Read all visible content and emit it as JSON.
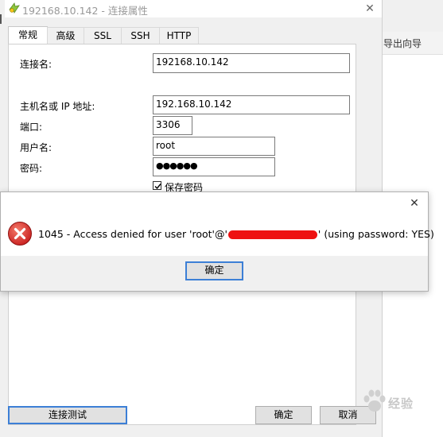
{
  "background_app": {
    "toolbar_label": "导出向导"
  },
  "dialog": {
    "title": "192168.10.142 - 连接属性",
    "tabs": [
      {
        "label": "常规",
        "active": true
      },
      {
        "label": "高级",
        "active": false
      },
      {
        "label": "SSL",
        "active": false
      },
      {
        "label": "SSH",
        "active": false
      },
      {
        "label": "HTTP",
        "active": false
      }
    ],
    "fields": {
      "connection_name": {
        "label": "连接名:",
        "value": "192168.10.142"
      },
      "host": {
        "label": "主机名或 IP 地址:",
        "value": "192.168.10.142"
      },
      "port": {
        "label": "端口:",
        "value": "3306"
      },
      "username": {
        "label": "用户名:",
        "value": "root"
      },
      "password": {
        "label": "密码:",
        "value": "●●●●●●"
      }
    },
    "save_password": {
      "label": "保存密码",
      "checked": true
    },
    "buttons": {
      "test": "连接测试",
      "ok": "确定",
      "cancel": "取消"
    }
  },
  "error_dialog": {
    "message_before": "1045 - Access denied for user 'root'@'",
    "message_after": "' (using password: YES)",
    "ok": "确定"
  },
  "watermark": {
    "text": "经验"
  },
  "colors": {
    "accent": "#3c7fd6",
    "error": "#d42b2b",
    "redaction": "#ee1111"
  }
}
